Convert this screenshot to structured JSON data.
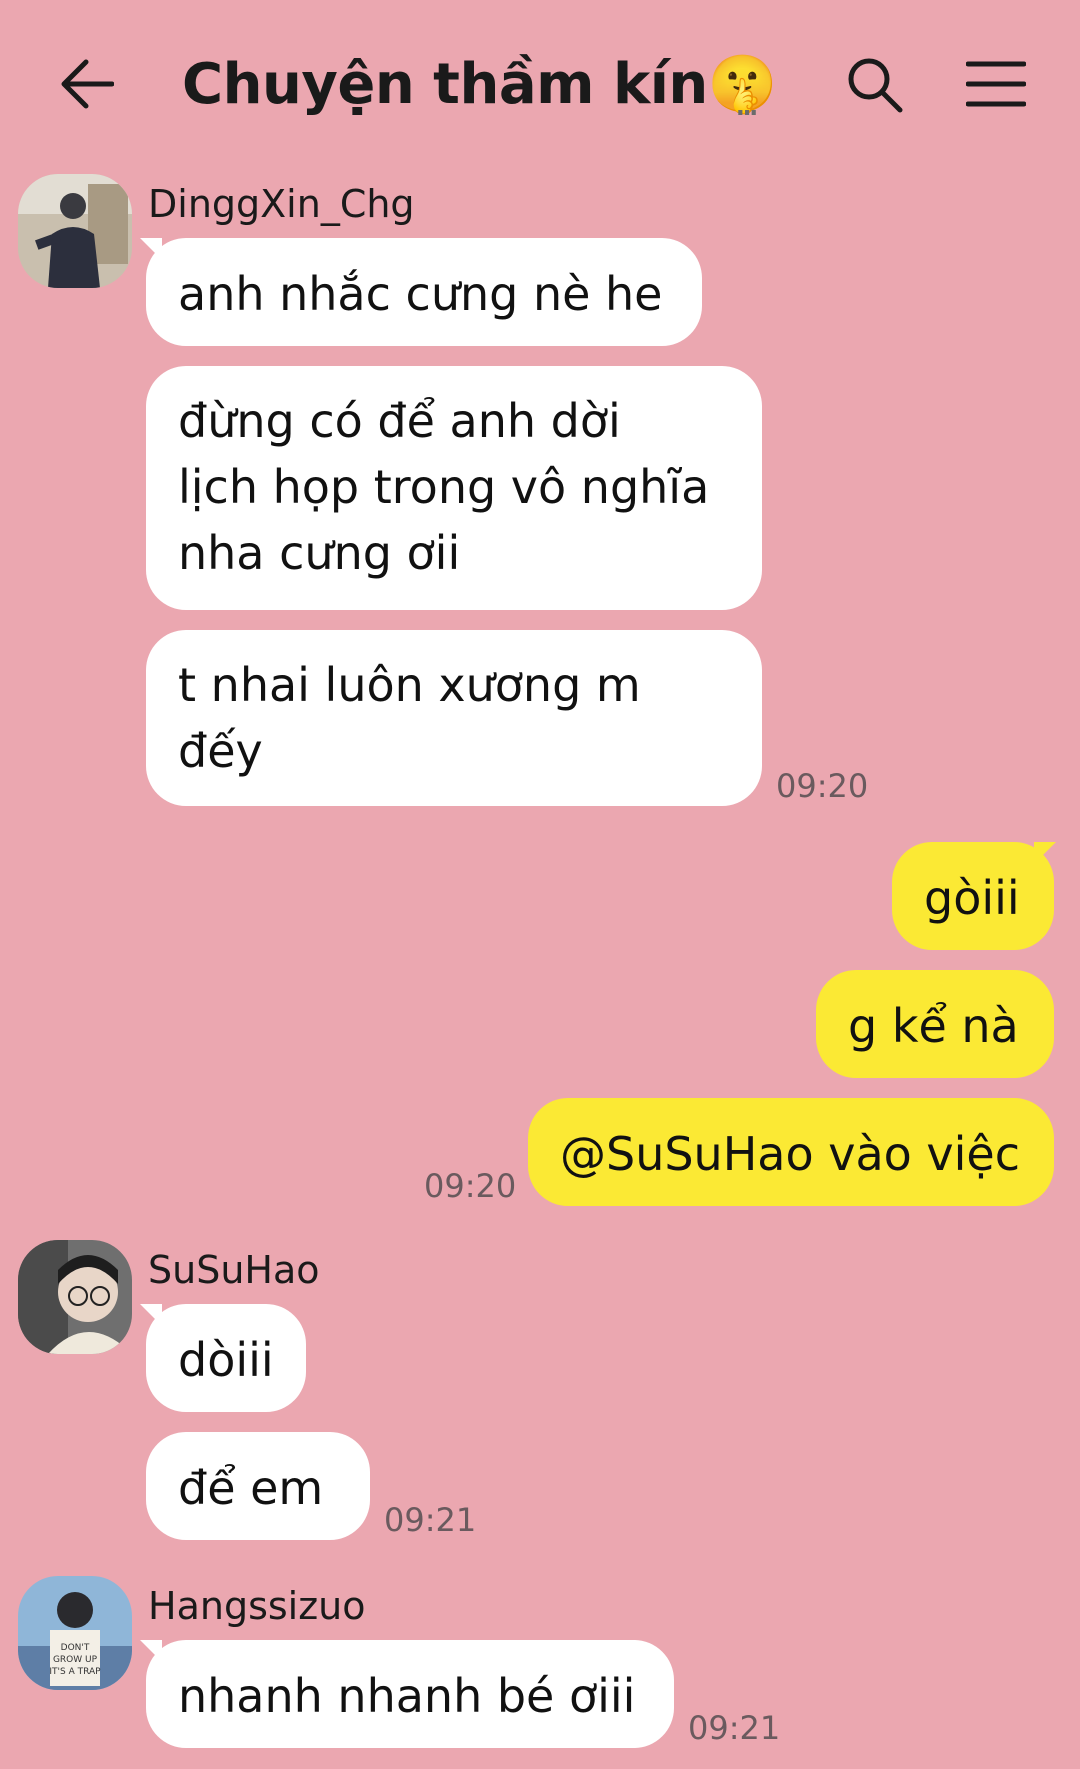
{
  "header": {
    "title": "Chuyện thầm kín🤫",
    "more": "...",
    "back_icon": "arrow-left-icon",
    "search_icon": "search-icon",
    "menu_icon": "hamburger-menu-icon"
  },
  "messages": [
    {
      "sender": "DinggXin_Chg",
      "bubbles": [
        "anh nhắc cưng nè he",
        "đừng có để anh dời\nlịch họp trong vô nghĩa\nnha cưng ơii",
        "t nhai luôn xương m\nđếy"
      ],
      "time": "09:20"
    },
    {
      "sender": "me",
      "bubbles": [
        "gòiii",
        "g kể nà",
        "@SuSuHao vào việc"
      ],
      "time": "09:20"
    },
    {
      "sender": "SuSuHao",
      "bubbles": [
        "dòiii",
        "để em"
      ],
      "time": "09:21"
    },
    {
      "sender": "Hangssizuo",
      "bubbles": [
        "nhanh nhanh bé ơiii"
      ],
      "time": "09:21"
    }
  ],
  "colors": {
    "background": "#eba7b0",
    "incoming_bubble": "#ffffff",
    "outgoing_bubble": "#fbe934"
  }
}
